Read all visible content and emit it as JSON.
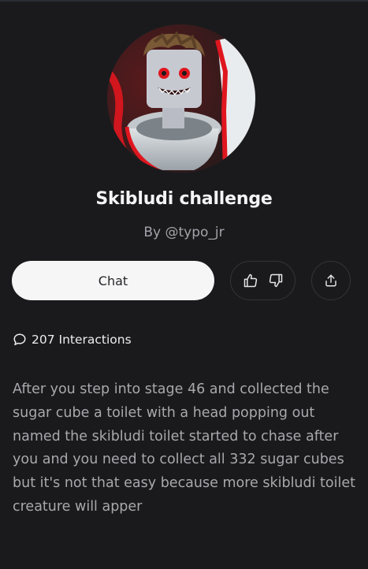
{
  "character": {
    "name": "Skibludi challenge",
    "author": "By @typo_jr",
    "avatar_icon": "skibidi-toilet-avatar"
  },
  "actions": {
    "chat_label": "Chat",
    "like_icon": "thumbs-up-icon",
    "dislike_icon": "thumbs-down-icon",
    "share_icon": "share-icon"
  },
  "stats": {
    "interactions": "207 Interactions",
    "interactions_icon": "chat-bubble-icon"
  },
  "description": "After you step into stage 46 and collected the sugar cube a toilet with a head popping out named the skibludi toilet started to chase after you and you need to collect all 332 sugar cubes but it's not that easy because more skibludi toilet creature will apper",
  "colors": {
    "background": "#1a1a1d",
    "chat_button": "#f6f6f7",
    "muted_text": "#a8a8ad",
    "accent_red": "#e0161f"
  }
}
